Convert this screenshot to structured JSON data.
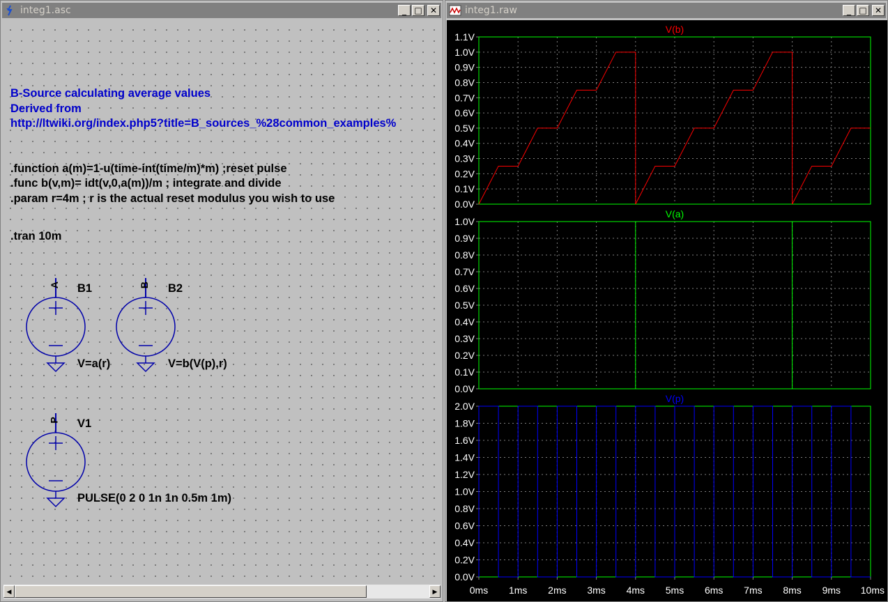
{
  "schematic_window": {
    "title": "integ1.asc",
    "buttons": {
      "minimize": "_",
      "maximize": "□",
      "close": "✕"
    },
    "comment_lines": [
      "B-Source calculating average values",
      "Derived from",
      "http://ltwiki.org/index.php5?title=B_sources_%28common_examples%"
    ],
    "directives": [
      ".function a(m)=1-u(time-int(time/m)*m) ;reset pulse",
      ".func b(v,m)= idt(v,0,a(m))/m ; integrate and divide",
      ".param r=4m ; r is the actual reset modulus you wish to use"
    ],
    "tran_directive": ".tran 10m",
    "components": [
      {
        "name": "B1",
        "net": "A",
        "value": "V=a(r)"
      },
      {
        "name": "B2",
        "net": "B",
        "value": "V=b(V(p),r)"
      },
      {
        "name": "V1",
        "net": "P",
        "value": "PULSE(0 2 0 1n 1n 0.5m 1m)"
      }
    ],
    "scroll": {
      "left": "◀",
      "right": "▶"
    }
  },
  "waveform_window": {
    "title": "integ1.raw",
    "buttons": {
      "minimize": "_",
      "maximize": "□",
      "close": "✕"
    }
  },
  "colors": {
    "vb": "#ff0000",
    "va": "#00ff00",
    "vp": "#0000ff",
    "grid": "#808080",
    "axis_text": "#ffffff",
    "plot_frame": "#00ff00"
  },
  "chart_data": [
    {
      "type": "line",
      "title": "V(b)",
      "x_unit": "ms",
      "x_ticks": [
        "0ms",
        "1ms",
        "2ms",
        "3ms",
        "4ms",
        "5ms",
        "6ms",
        "7ms",
        "8ms",
        "9ms",
        "10ms"
      ],
      "xlim": [
        0,
        10
      ],
      "y_ticks": [
        "0.0V",
        "0.1V",
        "0.2V",
        "0.3V",
        "0.4V",
        "0.5V",
        "0.6V",
        "0.7V",
        "0.8V",
        "0.9V",
        "1.0V",
        "1.1V"
      ],
      "ylim": [
        0,
        1.1
      ],
      "grid": true,
      "series": [
        {
          "name": "V(b)",
          "x": [
            0,
            0.5,
            1,
            1.5,
            2,
            2.5,
            3,
            3.5,
            4,
            4,
            4.5,
            5,
            5.5,
            6,
            6.5,
            7,
            7.5,
            8,
            8,
            8.5,
            9,
            9.5,
            10
          ],
          "y": [
            0,
            0.25,
            0.25,
            0.5,
            0.5,
            0.75,
            0.75,
            1.0,
            1.0,
            0,
            0.25,
            0.25,
            0.5,
            0.5,
            0.75,
            0.75,
            1.0,
            1.0,
            0,
            0.25,
            0.25,
            0.5,
            0.5
          ]
        }
      ]
    },
    {
      "type": "line",
      "title": "V(a)",
      "x_unit": "ms",
      "xlim": [
        0,
        10
      ],
      "y_ticks": [
        "0.0V",
        "0.1V",
        "0.2V",
        "0.3V",
        "0.4V",
        "0.5V",
        "0.6V",
        "0.7V",
        "0.8V",
        "0.9V",
        "1.0V"
      ],
      "ylim": [
        0,
        1.0
      ],
      "grid": true,
      "series": [
        {
          "name": "V(a)",
          "x": [
            0,
            0,
            4,
            4,
            4,
            8,
            8,
            8,
            10
          ],
          "y": [
            0,
            1,
            1,
            0,
            1,
            1,
            0,
            1,
            1
          ]
        }
      ]
    },
    {
      "type": "line",
      "title": "V(p)",
      "x_unit": "ms",
      "xlim": [
        0,
        10
      ],
      "y_ticks": [
        "0.0V",
        "0.2V",
        "0.4V",
        "0.6V",
        "0.8V",
        "1.0V",
        "1.2V",
        "1.4V",
        "1.6V",
        "1.8V",
        "2.0V"
      ],
      "ylim": [
        0,
        2.0
      ],
      "grid": true,
      "series": [
        {
          "name": "V(p)",
          "period_ms": 1,
          "width_ms": 0.5,
          "high": 2.0,
          "low": 0.0,
          "start_ms": 0,
          "end_ms": 10
        }
      ]
    }
  ]
}
